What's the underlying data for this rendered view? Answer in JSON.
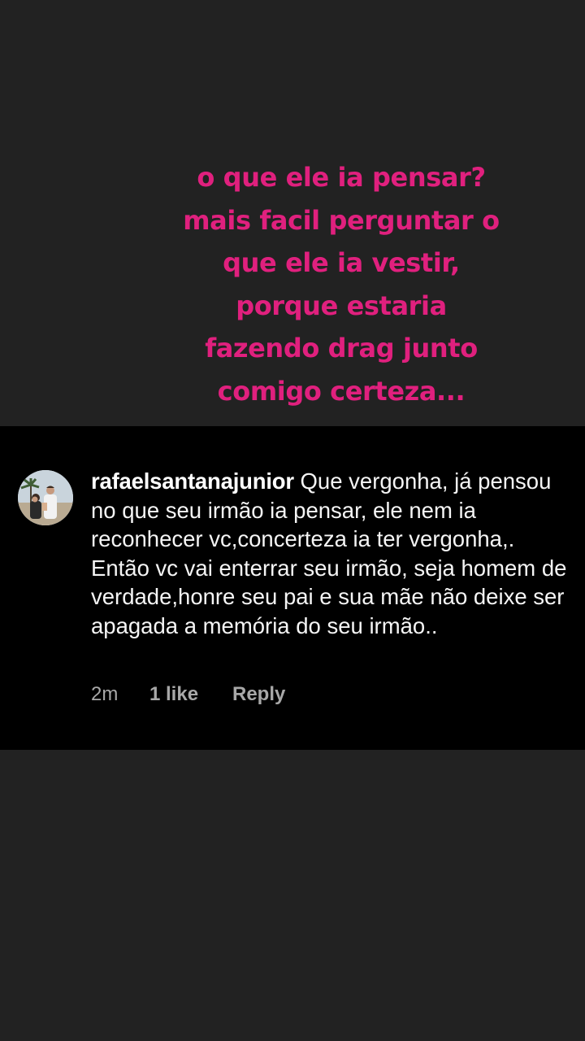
{
  "caption": {
    "lines": [
      "o que ele ia pensar?",
      "mais facil perguntar o",
      "que ele ia vestir,",
      "porque estaria",
      "fazendo drag junto",
      "comigo certeza..."
    ]
  },
  "comment": {
    "username": "rafaelsantanajunior",
    "text": "Que vergonha, já pensou no que seu irmão ia pensar, ele nem ia reconhecer vc,concerteza ia ter vergonha,. Então vc vai enterrar seu irmão, seja homem de verdade,honre seu pai e sua mãe não deixe ser apagada a memória do seu irmão..",
    "time": "2m",
    "likes": "1 like",
    "reply_label": "Reply"
  },
  "colors": {
    "background": "#222222",
    "caption_text": "#e0207e",
    "comment_background": "#000000",
    "comment_text": "#f5f5f5",
    "meta_text": "#a8a8a8"
  }
}
